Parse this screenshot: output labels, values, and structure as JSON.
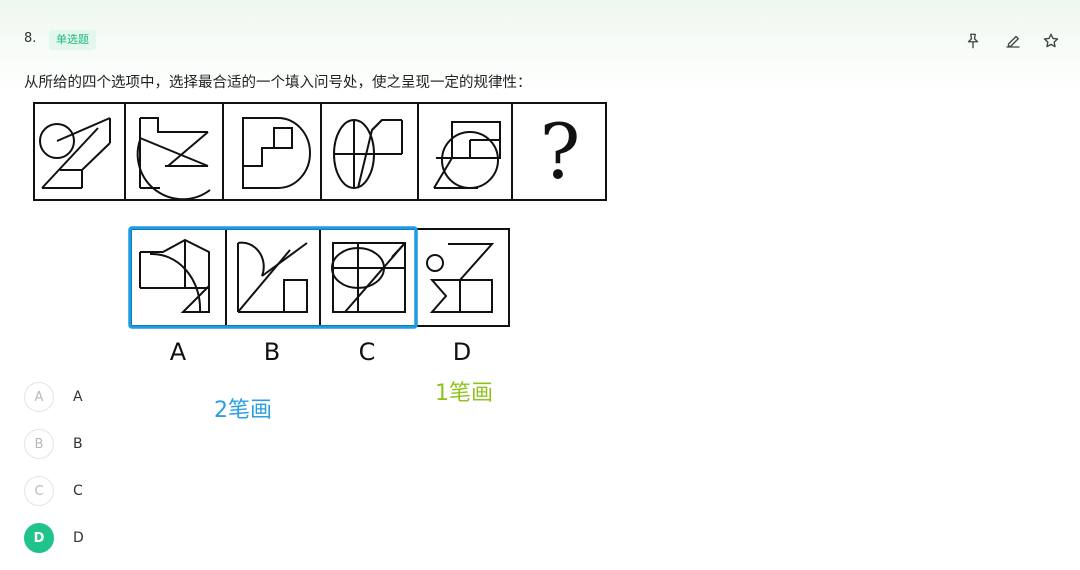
{
  "question": {
    "number": "8.",
    "type_badge": "单选题",
    "text": "从所给的四个选项中，选择最合适的一个填入问号处，使之呈现一定的规律性："
  },
  "toolbar": {
    "icons": [
      "pin-icon",
      "edit-icon",
      "star-icon"
    ]
  },
  "figure": {
    "question_mark": "?",
    "option_letters": [
      "A",
      "B",
      "C",
      "D"
    ],
    "annotation_2": "2笔画",
    "annotation_1": "1笔画",
    "colors": {
      "highlight": "#1e9be6",
      "annotation_2": "#2a9fe0",
      "annotation_1": "#8fc41f"
    }
  },
  "options": [
    {
      "circle": "A",
      "label": "A",
      "selected": false
    },
    {
      "circle": "B",
      "label": "B",
      "selected": false
    },
    {
      "circle": "C",
      "label": "C",
      "selected": false
    },
    {
      "circle": "D",
      "label": "D",
      "selected": true
    }
  ],
  "colors": {
    "accent": "#20c38a",
    "badge_bg": "#e3f7ee",
    "badge_text": "#1fb97a"
  }
}
